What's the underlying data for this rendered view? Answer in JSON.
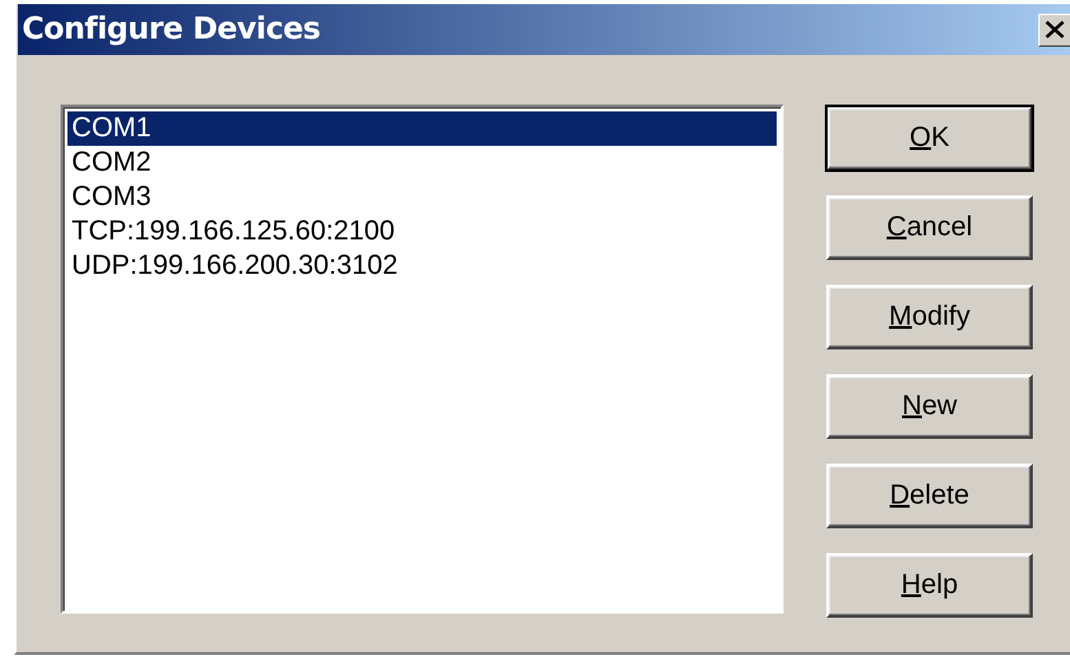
{
  "window": {
    "title": "Configure Devices"
  },
  "devices": [
    {
      "label": "COM1",
      "selected": true
    },
    {
      "label": "COM2",
      "selected": false
    },
    {
      "label": "COM3",
      "selected": false
    },
    {
      "label": "TCP:199.166.125.60:2100",
      "selected": false
    },
    {
      "label": "UDP:199.166.200.30:3102",
      "selected": false
    }
  ],
  "buttons": [
    {
      "label": "OK",
      "default": true
    },
    {
      "label": "Cancel",
      "default": false
    },
    {
      "label": "Modify",
      "default": false
    },
    {
      "label": "New",
      "default": false
    },
    {
      "label": "Delete",
      "default": false
    },
    {
      "label": "Help",
      "default": false
    }
  ]
}
